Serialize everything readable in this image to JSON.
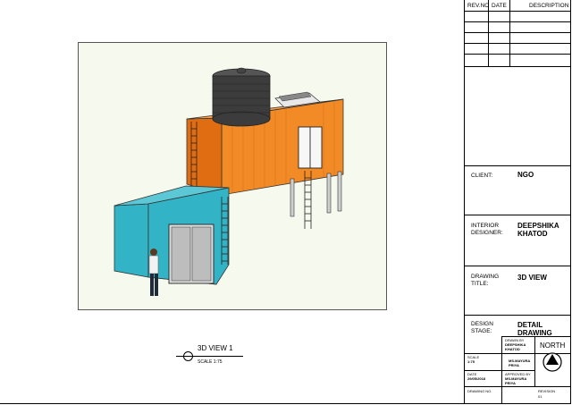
{
  "revision_table": {
    "headers": [
      "REV.NO",
      "DATE",
      "DESCRIPTION"
    ],
    "empty_rows": 4
  },
  "title_block": {
    "client_label": "CLIENT:",
    "client_value": "NGO",
    "designer_label_1": "INTERIOR",
    "designer_label_2": "DESIGNER:",
    "designer_value_1": "DEEPSHIKA",
    "designer_value_2": "KHATOD",
    "drawing_title_label_1": "DRAWING",
    "drawing_title_label_2": "TITLE:",
    "drawing_title_value": "3D VIEW",
    "design_stage_label_1": "DESIGN",
    "design_stage_label_2": "STAGE:",
    "design_stage_value_1": "DETAIL",
    "design_stage_value_2": "DRAWING",
    "drawn_by_label": "DRAWN BY",
    "drawn_by_value_1": "DEEPSHIKA",
    "drawn_by_value_2": "KHATOD",
    "north_label": "NORTH",
    "scale_label": "SCALE",
    "scale_value": "1:75",
    "checked_by_value_1": "MS.MAYURA",
    "checked_by_value_2": "PRIYA",
    "date_label": "DATE",
    "date_value": "29/05/2018",
    "approved_by_label": "APPROVED BY",
    "approved_by_value_1": "MS.MAYURA",
    "approved_by_value_2": "PRIYA",
    "drawing_no_label": "DRAWING NO.",
    "revision_label": "REVISION",
    "revision_value": "01"
  },
  "view": {
    "name": "3D VIEW 1",
    "scale": "SCALE 1:75"
  },
  "colors": {
    "upper_container": "#f28a26",
    "lower_container": "#33b4c6",
    "tank": "#3c3c3c",
    "background": "#f6f9ee"
  }
}
